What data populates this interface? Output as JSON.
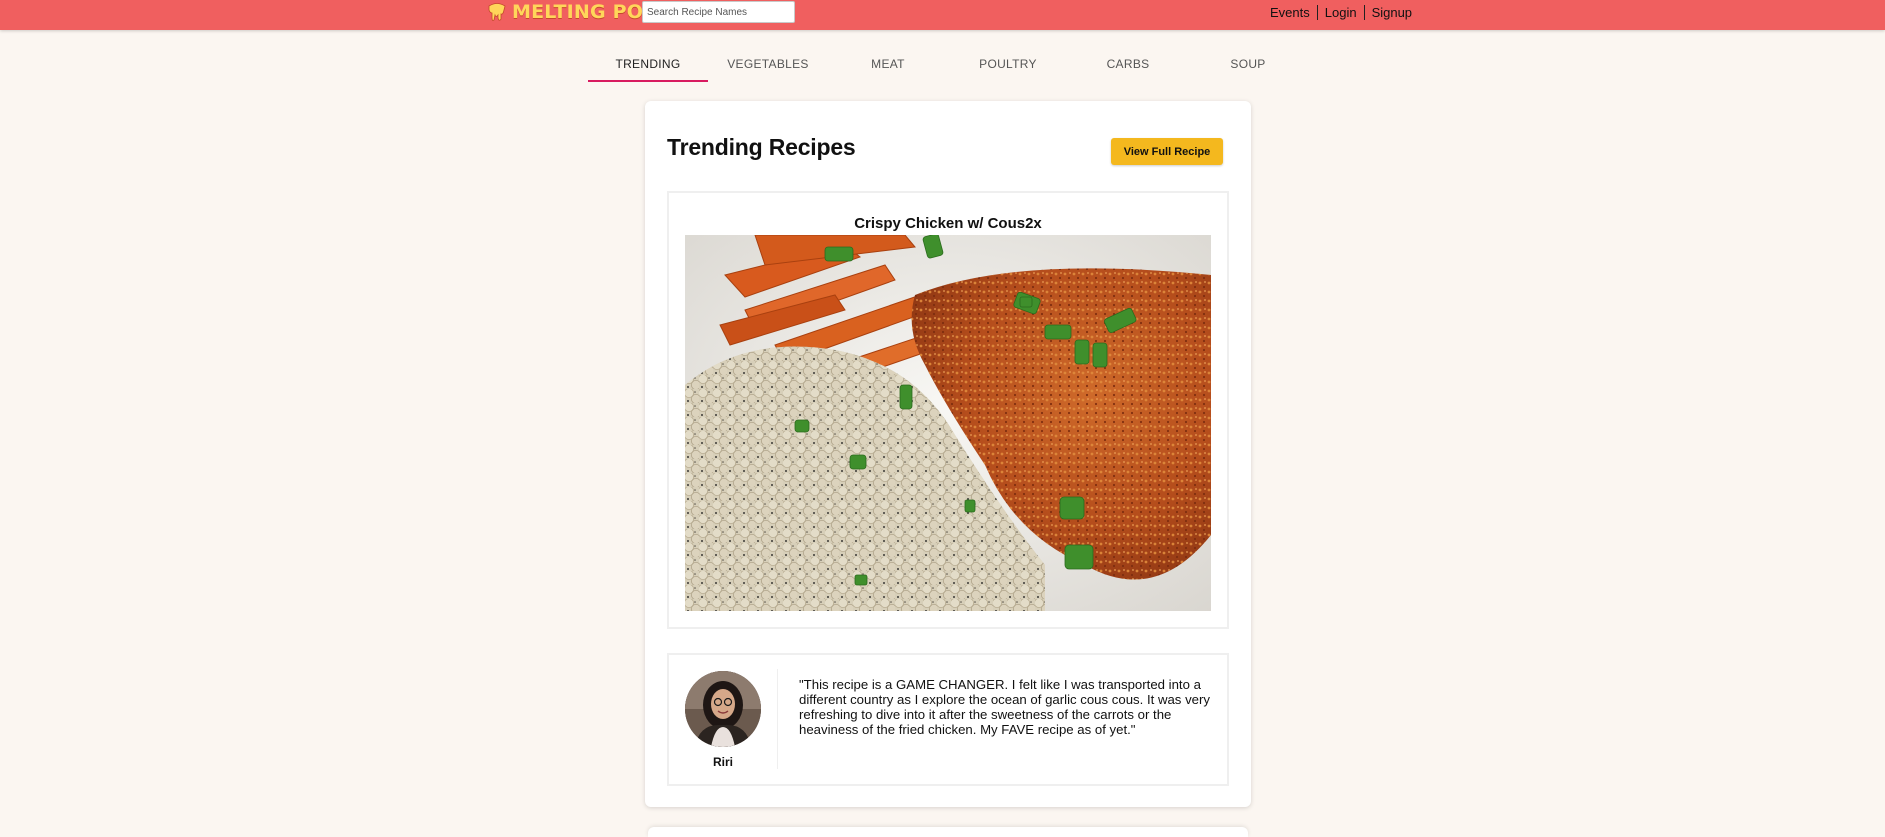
{
  "header": {
    "logo_text": "MELTING POT",
    "search_placeholder": "Search Recipe Names",
    "links": [
      "Events",
      "Login",
      "Signup"
    ],
    "bar_color": "#f05f5f"
  },
  "tabs": [
    {
      "label": "TRENDING",
      "active": true
    },
    {
      "label": "VEGETABLES",
      "active": false
    },
    {
      "label": "MEAT",
      "active": false
    },
    {
      "label": "POULTRY",
      "active": false
    },
    {
      "label": "CARBS",
      "active": false
    },
    {
      "label": "SOUP",
      "active": false
    }
  ],
  "card": {
    "title": "Trending Recipes",
    "button_label": "View Full Recipe",
    "recipe_name": "Crispy Chicken w/ Cous2x",
    "review": {
      "reviewer": "Riri",
      "quote": "\"This recipe is a GAME CHANGER. I felt like I was transported into a different country as I explore the ocean of garlic cous cous. It was very refreshing to dive into it after the sweetness of the carrots or the heaviness of the fried chicken. My FAVE recipe as of yet.\""
    }
  },
  "colors": {
    "accent_tab": "#d81b60",
    "button": "#f4b81e",
    "background": "#fbf6f1"
  }
}
